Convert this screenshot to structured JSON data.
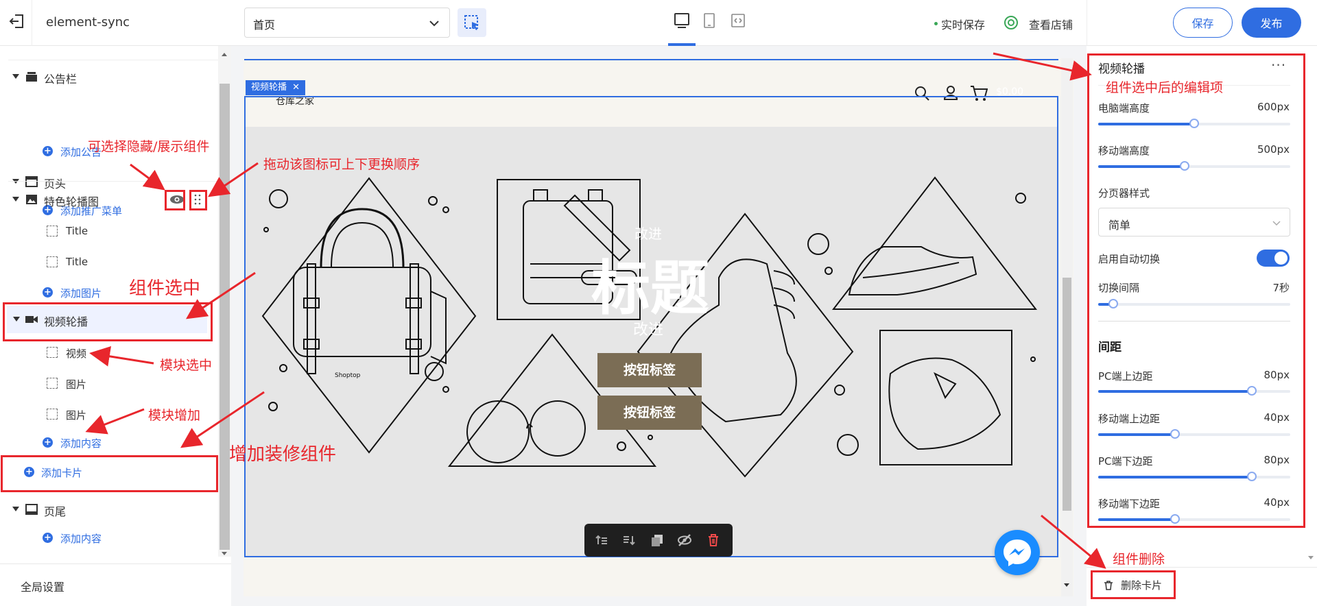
{
  "header": {
    "app_name": "element-sync",
    "page_select_value": "首页",
    "autosave": "实时保存",
    "view_store": "查看店铺",
    "save": "保存",
    "publish": "发布"
  },
  "sidebar": {
    "sections": [
      {
        "label": "公告栏",
        "add": "添加公告"
      },
      {
        "label": "页头",
        "add": "添加推广菜单"
      },
      {
        "label": "特色轮播图",
        "children": [
          "Title",
          "Title"
        ],
        "add": "添加图片"
      },
      {
        "label": "视频轮播",
        "children": [
          "视频",
          "图片",
          "图片"
        ],
        "add": "添加内容"
      },
      {
        "label": "页尾",
        "add": "添加内容"
      }
    ],
    "add_card": "添加卡片",
    "global_settings": "全局设置"
  },
  "canvas": {
    "selected_tag": "视频轮播",
    "store_name": "仓库之家",
    "cart_price": "$0.00",
    "bag_brand": "Shoptop",
    "hero_subtitle": "改进",
    "hero_title": "标题",
    "hero_subtitle2": "改进",
    "button1": "按钮标签",
    "button2": "按钮标签"
  },
  "panel": {
    "title": "视频轮播",
    "more": "···",
    "desktop_height_label": "电脑端高度",
    "desktop_height_value": "600px",
    "desktop_height_level": 0.5,
    "mobile_height_label": "移动端高度",
    "mobile_height_value": "500px",
    "mobile_height_level": 0.45,
    "pager_style_label": "分页器样式",
    "pager_style_value": "简单",
    "autoplay_label": "启用自动切换",
    "interval_label": "切换间隔",
    "interval_value": "7秒",
    "interval_level": 0.08,
    "spacing_title": "间距",
    "pc_top_label": "PC端上边距",
    "pc_top_value": "80px",
    "pc_top_level": 0.8,
    "mobile_top_label": "移动端上边距",
    "mobile_top_value": "40px",
    "mobile_top_level": 0.4,
    "pc_bottom_label": "PC端下边距",
    "pc_bottom_value": "80px",
    "pc_bottom_level": 0.8,
    "mobile_bottom_label": "移动端下边距",
    "mobile_bottom_value": "40px",
    "mobile_bottom_level": 0.4,
    "delete_card": "删除卡片"
  },
  "annotations": {
    "hide_show": "可选择隐藏/展示组件",
    "drag": "拖动该图标可上下更换顺序",
    "component_selected": "组件选中",
    "module_selected": "模块选中",
    "module_add": "模块增加",
    "add_component": "增加装修组件",
    "edit_items": "组件选中后的编辑项",
    "delete_component": "组件删除"
  },
  "colors": {
    "accent": "#2f6de1",
    "annotation": "#e8262c",
    "button": "#7b6d55"
  }
}
